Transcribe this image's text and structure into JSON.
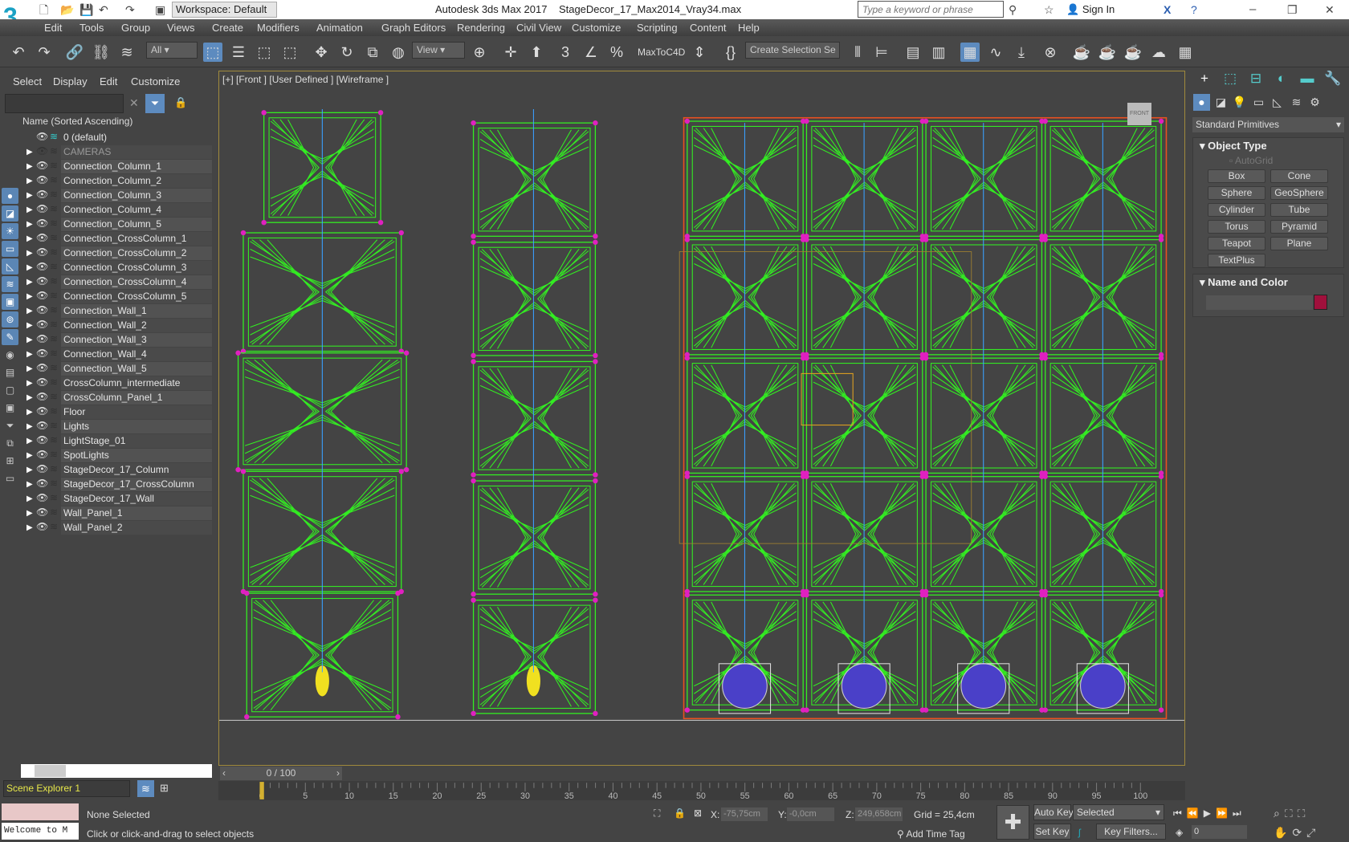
{
  "titlebar": {
    "app": "Autodesk 3ds Max 2017",
    "file": "StageDecor_17_Max2014_Vray34.max",
    "workspace": "Workspace: Default",
    "search_placeholder": "Type a keyword or phrase",
    "sign_in": "Sign In",
    "logo": "3"
  },
  "menu": [
    "Edit",
    "Tools",
    "Group",
    "Views",
    "Create",
    "Modifiers",
    "Animation",
    "Graph Editors",
    "Rendering",
    "Civil View",
    "Customize",
    "Scripting",
    "Content",
    "Help"
  ],
  "toolbar": {
    "filter": "All",
    "ref_coord": "View",
    "maxtoc4d": "MaxToC4D",
    "selection_set": "Create Selection Se"
  },
  "scene_explorer": {
    "menu": [
      "Select",
      "Display",
      "Edit",
      "Customize"
    ],
    "column_header": "Name (Sorted Ascending)",
    "items": [
      "0 (default)",
      "CAMERAS",
      "Connection_Column_1",
      "Connection_Column_2",
      "Connection_Column_3",
      "Connection_Column_4",
      "Connection_Column_5",
      "Connection_CrossColumn_1",
      "Connection_CrossColumn_2",
      "Connection_CrossColumn_3",
      "Connection_CrossColumn_4",
      "Connection_CrossColumn_5",
      "Connection_Wall_1",
      "Connection_Wall_2",
      "Connection_Wall_3",
      "Connection_Wall_4",
      "Connection_Wall_5",
      "CrossColumn_intermediate",
      "CrossColumn_Panel_1",
      "Floor",
      "Lights",
      "LightStage_01",
      "SpotLights",
      "StageDecor_17_Column",
      "StageDecor_17_CrossColumn",
      "StageDecor_17_Wall",
      "Wall_Panel_1",
      "Wall_Panel_2"
    ],
    "name": "Scene Explorer 1"
  },
  "viewport": {
    "label": "[+] [Front ] [User Defined ] [Wireframe ]",
    "viewcube": "FRONT",
    "wire_color": "#33ee22"
  },
  "command_panel": {
    "category": "Standard Primitives",
    "object_type": "Object Type",
    "autogrid": "AutoGrid",
    "buttons": [
      "Box",
      "Cone",
      "Sphere",
      "GeoSphere",
      "Cylinder",
      "Tube",
      "Torus",
      "Pyramid",
      "Teapot",
      "Plane",
      "TextPlus"
    ],
    "name_and_color": "Name and Color",
    "object_color": "#a0103c"
  },
  "timeline": {
    "frame": "0 / 100",
    "ticks": [
      "0",
      "5",
      "10",
      "15",
      "20",
      "25",
      "30",
      "35",
      "40",
      "45",
      "50",
      "55",
      "60",
      "65",
      "70",
      "75",
      "80",
      "85",
      "90",
      "95",
      "100"
    ]
  },
  "status": {
    "selection": "None Selected",
    "prompt": "Click or click-and-drag to select objects",
    "listener": "Welcome to M",
    "x_label": "X:",
    "x": "-75,75cm",
    "y_label": "Y:",
    "y": "-0,0cm",
    "z_label": "Z:",
    "z": "249,658cm",
    "grid": "Grid = 25,4cm",
    "add_time_tag": "Add Time Tag",
    "auto_key": "Auto Key",
    "set_key": "Set Key",
    "key_mode": "Selected",
    "key_filters": "Key Filters...",
    "current_frame": "0"
  }
}
